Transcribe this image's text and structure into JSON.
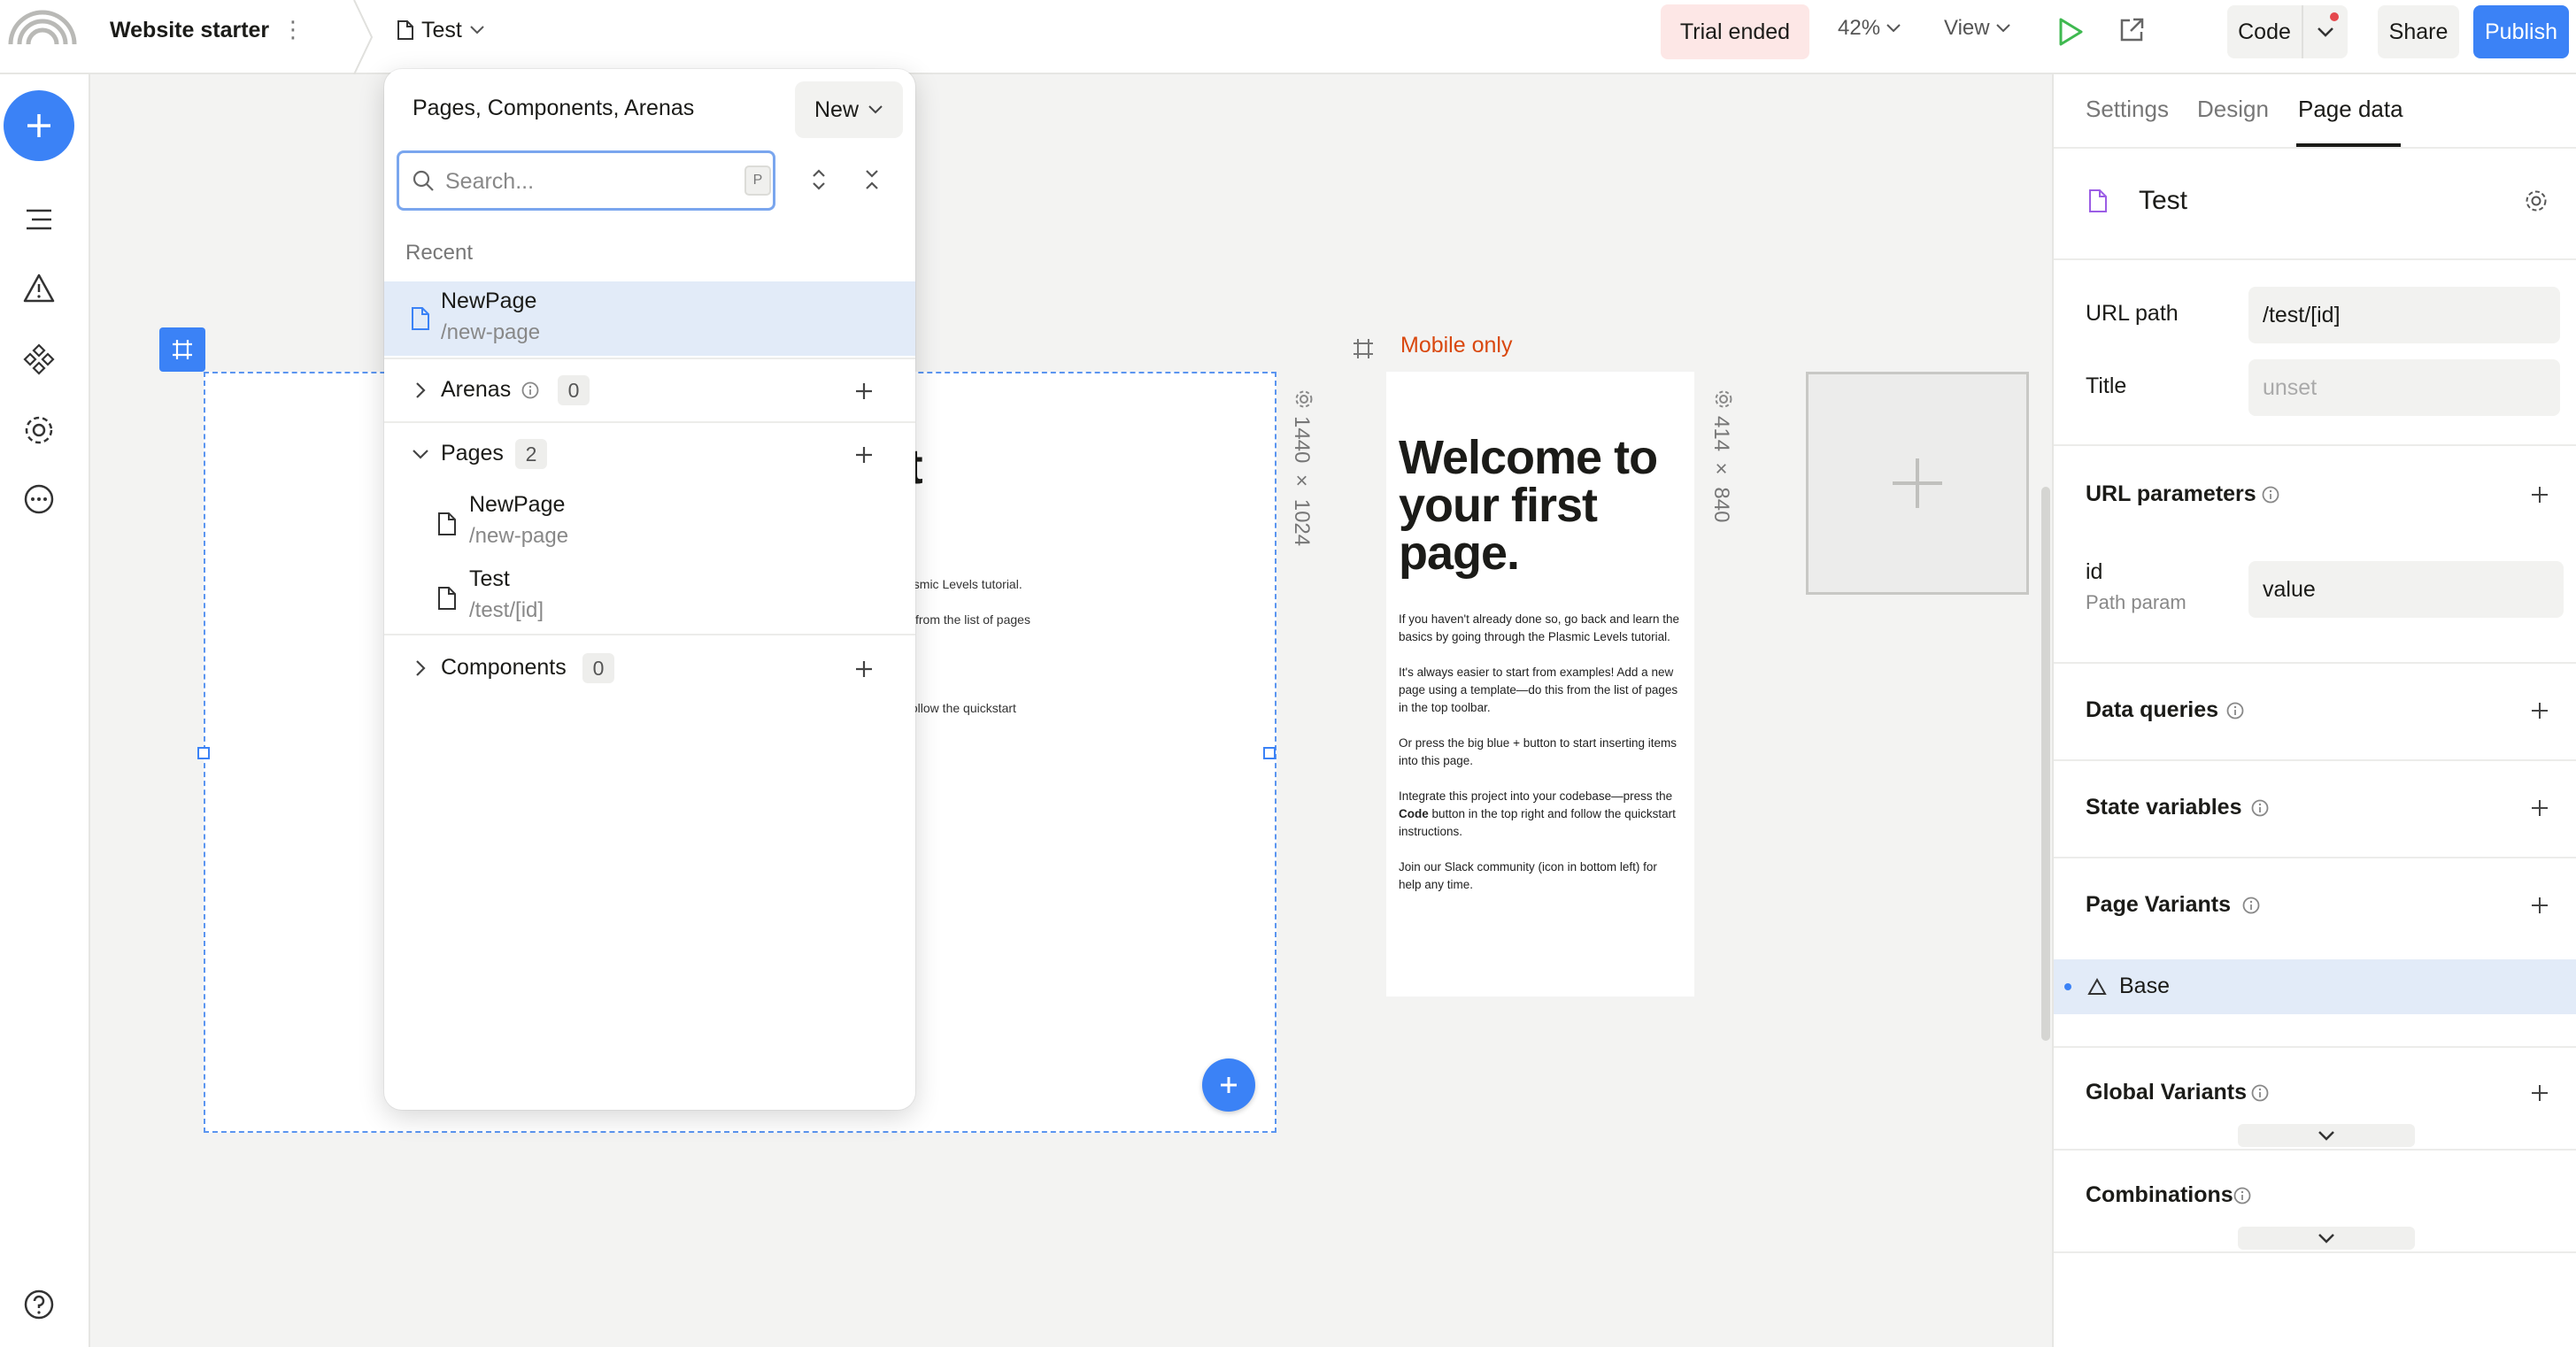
{
  "topbar": {
    "project_name": "Website starter",
    "current_page": "Test",
    "trial_status": "Trial ended",
    "zoom": "42%",
    "view_label": "View",
    "code_label": "Code",
    "share_label": "Share",
    "publish_label": "Publish"
  },
  "colors": {
    "accent": "#3b82f6",
    "trial_bg": "#fde7e6",
    "mobile_label": "#d9480f",
    "selected_row": "#e2ebf8",
    "play_green": "#3fb950"
  },
  "left_rail": {
    "icons": [
      "add-icon",
      "outline-icon",
      "warning-icon",
      "components-icon",
      "settings-icon",
      "more-icon",
      "help-icon"
    ]
  },
  "popover": {
    "title": "Pages, Components, Arenas",
    "new_label": "New",
    "search_placeholder": "Search...",
    "search_shortcut": "P",
    "recent_label": "Recent",
    "recent_items": [
      {
        "name": "NewPage",
        "path": "/new-page"
      }
    ],
    "arenas": {
      "label": "Arenas",
      "count": "0"
    },
    "pages": {
      "label": "Pages",
      "count": "2",
      "items": [
        {
          "name": "NewPage",
          "path": "/new-page"
        },
        {
          "name": "Test",
          "path": "/test/[id]"
        }
      ]
    },
    "components": {
      "label": "Components",
      "count": "0"
    }
  },
  "canvas": {
    "desktop_size": "1440 × 1024",
    "desktop_heading_fragment": "t",
    "desktop_text_fragments": [
      "asmic Levels tutorial.",
      "from the list of pages",
      "l follow the quickstart"
    ],
    "mobile_label": "Mobile only",
    "mobile_size": "414 × 840",
    "mobile_heading": "Welcome to your first page.",
    "mobile_paragraphs": [
      "If you haven't already done so, go back and learn the basics by going through the Plasmic Levels tutorial.",
      "It's always easier to start from examples! Add a new page using a template—do this from the list of pages in the top toolbar.",
      "Or press the big blue + button to start inserting items into this page.",
      "Join our Slack community (icon in bottom left) for help any time."
    ],
    "mobile_code_para": {
      "before": "Integrate this project into your codebase—press the ",
      "bold": "Code",
      "after": " button in the top right and follow the quickstart instructions."
    }
  },
  "right_panel": {
    "tabs": [
      "Settings",
      "Design",
      "Page data"
    ],
    "active_tab": "Page data",
    "page_title": "Test",
    "url_path_label": "URL path",
    "url_path_value": "/test/[id]",
    "title_label": "Title",
    "title_placeholder": "unset",
    "url_params_label": "URL parameters",
    "param_name": "id",
    "param_type": "Path param",
    "param_value": "value",
    "data_queries_label": "Data queries",
    "state_variables_label": "State variables",
    "page_variants_label": "Page Variants",
    "base_variant": "Base",
    "global_variants_label": "Global Variants",
    "combinations_label": "Combinations"
  }
}
